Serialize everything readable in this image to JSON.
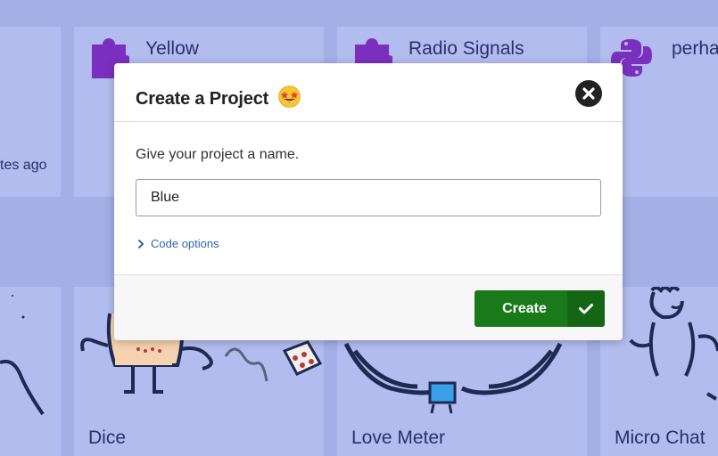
{
  "background": {
    "cards_top": [
      {
        "title": "",
        "subtitle": "tes ago"
      },
      {
        "title": "Yellow"
      },
      {
        "title": "Radio Signals"
      },
      {
        "title": "perha"
      }
    ],
    "cards_bottom": [
      {
        "title": ""
      },
      {
        "title": "Dice"
      },
      {
        "title": "Love Meter"
      },
      {
        "title": "Micro Chat"
      }
    ]
  },
  "modal": {
    "title": "Create a Project",
    "emoji_icon": "star-struck-emoji",
    "close_icon": "close-icon",
    "prompt": "Give your project a name.",
    "input_value": "Blue",
    "input_placeholder": "",
    "code_options_label": "Code options",
    "create_label": "Create",
    "create_icon": "check-icon"
  },
  "colors": {
    "background": "#a4afe6",
    "card": "#b3bcef",
    "create_button": "#1a7a19",
    "puzzle": "#7b2fbf"
  }
}
